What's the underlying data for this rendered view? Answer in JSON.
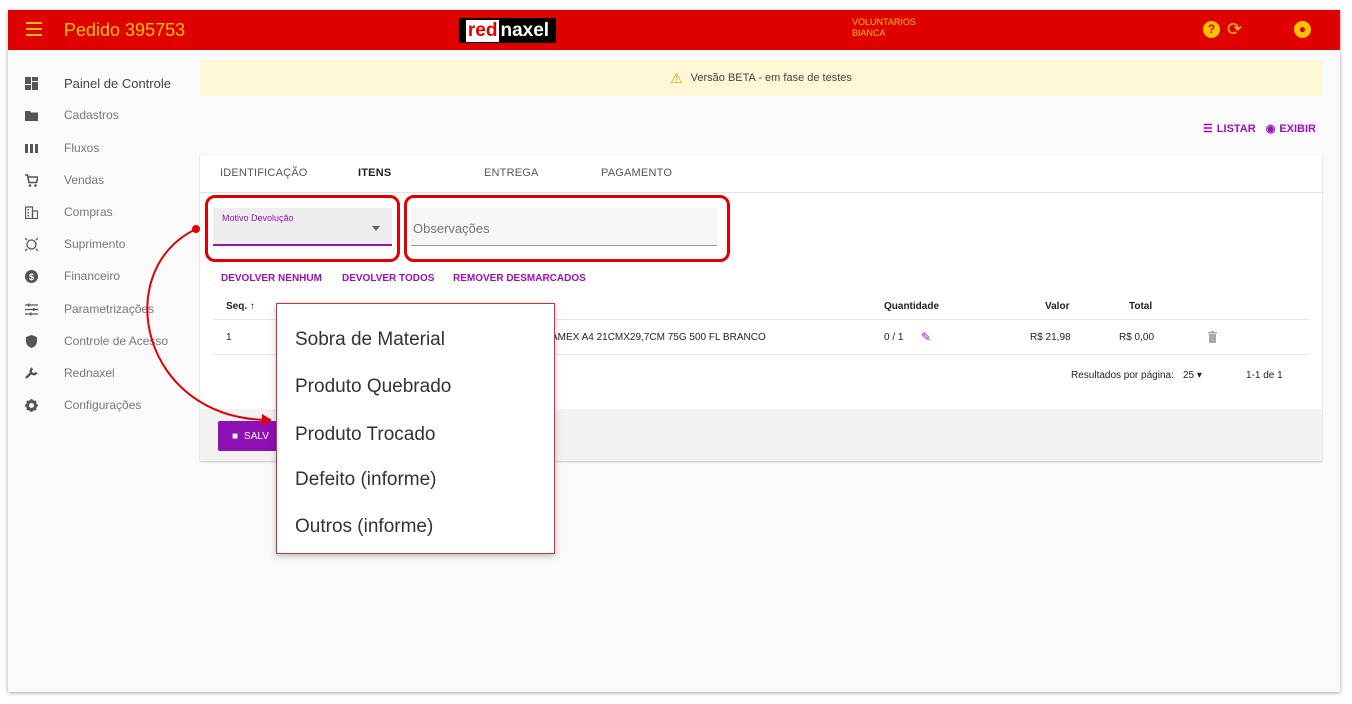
{
  "header": {
    "title": "Pedido 395753",
    "logo_part1": "red",
    "logo_part2": "naxel",
    "user_line1": "VOLUNTARIOS",
    "user_line2": "BIANCA"
  },
  "sidebar": {
    "items": [
      {
        "label": "Painel de Controle"
      },
      {
        "label": "Cadastros"
      },
      {
        "label": "Fluxos"
      },
      {
        "label": "Vendas"
      },
      {
        "label": "Compras"
      },
      {
        "label": "Suprimento"
      },
      {
        "label": "Financeiro"
      },
      {
        "label": "Parametrizações"
      },
      {
        "label": "Controle de Acesso"
      },
      {
        "label": "Rednaxel"
      },
      {
        "label": "Configurações"
      }
    ]
  },
  "banner": {
    "text": "Versão BETA - em fase de testes"
  },
  "view_actions": {
    "list": "LISTAR",
    "view": "EXIBIR"
  },
  "tabs": [
    {
      "label": "IDENTIFICAÇÃO"
    },
    {
      "label": "ITENS"
    },
    {
      "label": "ENTREGA"
    },
    {
      "label": "PAGAMENTO"
    }
  ],
  "form": {
    "reason_label": "Motivo Devolução",
    "obs_placeholder": "Observações"
  },
  "actions": {
    "return_none": "DEVOLVER NENHUM",
    "return_all": "DEVOLVER TODOS",
    "remove_unchecked": "REMOVER DESMARCADOS"
  },
  "table": {
    "headers": {
      "seq": "Seq.",
      "quantity": "Quantidade",
      "value": "Valor",
      "total": "Total"
    },
    "rows": [
      {
        "seq": "1",
        "product": "AMEX A4 21CMX29,7CM 75G 500 FL BRANCO",
        "quantity": "0 / 1",
        "value": "R$ 21,98",
        "total": "R$ 0,00"
      }
    ]
  },
  "pagination": {
    "label": "Resultados por página:",
    "per_page": "25",
    "range": "1-1 de 1"
  },
  "save_button": {
    "label": "SALV"
  },
  "dropdown": {
    "options": [
      "Sobra de Material",
      "Produto Quebrado",
      "Produto Trocado",
      "Defeito (informe)",
      "Outros (informe)"
    ]
  },
  "colors": {
    "brand_red": "#e10000",
    "accent_yellow": "#f5c400",
    "accent_purple": "#9c10b8"
  }
}
